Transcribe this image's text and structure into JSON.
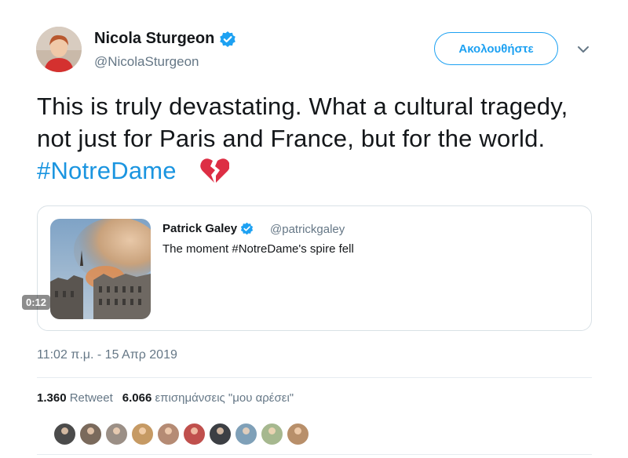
{
  "author": {
    "name": "Nicola Sturgeon",
    "handle": "@NicolaSturgeon",
    "verified_icon": "verified-badge-icon"
  },
  "follow_button": {
    "label": "Ακολουθήστε"
  },
  "tweet": {
    "text_before": "This is truly devastating. What a cultural tragedy, not just for Paris and France, but for the world.",
    "hashtag": "#NotreDame",
    "emoji": "broken-heart-icon"
  },
  "quote": {
    "author_name": "Patrick Galey",
    "author_handle": "@patrickgaley",
    "text": "The moment #NotreDame's spire fell",
    "video_duration": "0:12"
  },
  "timestamp": "11:02 π.μ. - 15 Απρ 2019",
  "stats": {
    "retweets_count": "1.360",
    "retweets_label": "Retweet",
    "likes_count": "6.066",
    "likes_label": "επισημάνσεις \"μου αρέσει\""
  },
  "likers": [
    {
      "color": "#4b4b4b"
    },
    {
      "color": "#7a6a5c"
    },
    {
      "color": "#9b8f86"
    },
    {
      "color": "#c69a64"
    },
    {
      "color": "#b58b74"
    },
    {
      "color": "#c0504d"
    },
    {
      "color": "#3c3f44"
    },
    {
      "color": "#7fa0b8"
    },
    {
      "color": "#a6b88f"
    },
    {
      "color": "#b88f6a"
    }
  ],
  "colors": {
    "accent": "#1da1f2",
    "hashtag": "#1b95e0",
    "secondary_text": "#657786"
  }
}
